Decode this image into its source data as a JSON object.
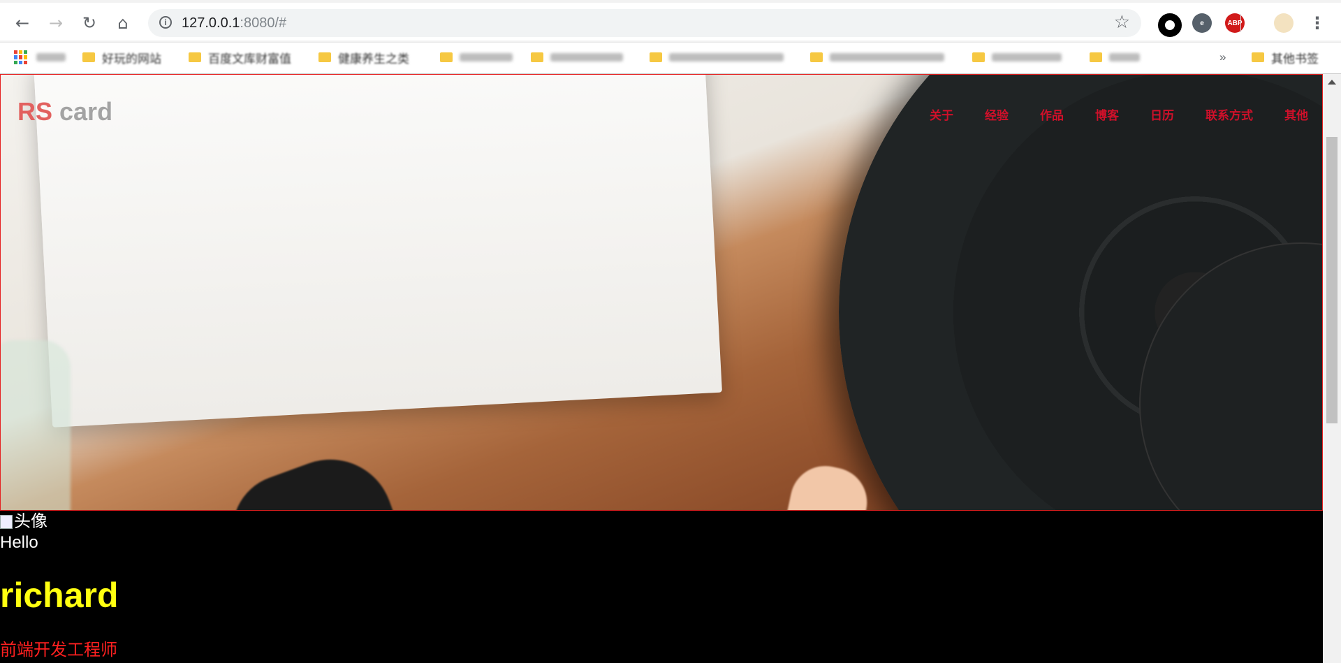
{
  "browser": {
    "url_host": "127.0.0.1",
    "url_rest": ":8080/#",
    "extensions": [
      "o-icon",
      "e-icon",
      "ABP",
      "avatar-icon"
    ],
    "bookmarks": [
      {
        "label": "好玩的网站"
      },
      {
        "label": "百度文库财富值"
      },
      {
        "label": "健康养生之类"
      },
      {
        "label": ""
      },
      {
        "label": ""
      },
      {
        "label": ""
      },
      {
        "label": ""
      },
      {
        "label": ""
      },
      {
        "label": ""
      }
    ],
    "overflow": "»",
    "other_bookmarks": "其他书签"
  },
  "header": {
    "logo_rs": "RS",
    "logo_card": " card",
    "nav": [
      "关于",
      "经验",
      "作品",
      "博客",
      "日历",
      "联系方式",
      "其他"
    ]
  },
  "profile": {
    "avatar_alt": "头像",
    "greeting": "Hello",
    "name": "richard",
    "role": "前端开发工程师"
  },
  "colors": {
    "logo_rs": "#e2615f",
    "logo_card": "#a3a3a3",
    "nav": "#d0102a",
    "name": "#ffff10",
    "role": "#ff2020",
    "hero_border": "#e52020"
  }
}
